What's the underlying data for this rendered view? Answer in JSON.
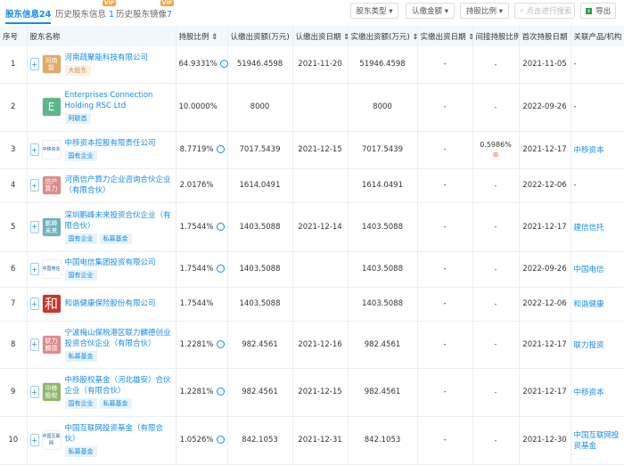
{
  "tabs": [
    {
      "label": "股东信息",
      "count": "24",
      "active": true
    },
    {
      "label": "历史股东信息",
      "count": "1",
      "vip": "VIP"
    },
    {
      "label": "历史股东镜像",
      "count": "7",
      "vip": "VIP"
    }
  ],
  "toolbar": {
    "filter_type": "股东类型 ▾",
    "filter_amount": "认缴金额 ▾",
    "filter_ratio": "持股比例 ▾",
    "search_placeholder": "点击进行搜索",
    "export": "导出"
  },
  "columns": [
    "序号",
    "股东名称",
    "持股比例 ⇕",
    "认缴出资额(万元) ⇕",
    "认缴出资日期 ⇕",
    "实缴出资额(万元) ⇕",
    "实缴出资日期 ⇕",
    "间接持股比例",
    "首次持股日期 ⇕",
    "关联产品/机构"
  ],
  "colors": {
    "accent": "#128bed",
    "header_bg": "#f2f9fc"
  },
  "rows": [
    {
      "no": "1",
      "logo": "河南\n能",
      "logo_color": "#e3a866",
      "name": "河南疏聚能科技有限公司",
      "tags": [
        "大股东"
      ],
      "ratio": "64.9331%",
      "sub_amt": "51946.4598",
      "sub_date": "2021-11-20",
      "paid_amt": "51946.4598",
      "paid_date": "-",
      "indirect": "-",
      "first_date": "2021-11-05",
      "related": "-",
      "plus": true,
      "clock": true
    },
    {
      "no": "2",
      "logo": "E",
      "logo_color": "#5cb88a",
      "name": "Enterprises Connection Holding RSC Ltd",
      "tags": [
        "阿联酋"
      ],
      "ratio": "10.0000%",
      "sub_amt": "8000",
      "sub_date": "",
      "paid_amt": "8000",
      "paid_date": "-",
      "indirect": "-",
      "first_date": "2022-09-26",
      "related": "-"
    },
    {
      "no": "3",
      "logo": "中移资本",
      "logo_color": "#ffffff",
      "name": "中移资本控股有限责任公司",
      "tags": [
        "国有企业"
      ],
      "ratio": "8.7719%",
      "sub_amt": "7017.5439",
      "sub_date": "2021-12-15",
      "paid_amt": "7017.5439",
      "paid_date": "-",
      "indirect": "0.5986%",
      "first_date": "2021-12-17",
      "related": "中移资本",
      "plus": true,
      "clock": true
    },
    {
      "no": "4",
      "logo": "信产\n算力",
      "logo_color": "#e08a8a",
      "name": "河南信产算力企业咨询合伙企业（有限合伙）",
      "tags": [],
      "ratio": "2.0176%",
      "sub_amt": "1614.0491",
      "sub_date": "",
      "paid_amt": "1614.0491",
      "paid_date": "-",
      "indirect": "-",
      "first_date": "2022-12-06",
      "related": "-",
      "plus": true
    },
    {
      "no": "5",
      "logo": "鹏峰\n未来",
      "logo_color": "#6bb3bf",
      "name": "深圳鹏峰未来投资合伙企业（有限合伙）",
      "tags": [
        "国有企业",
        "私募基金"
      ],
      "ratio": "1.7544%",
      "sub_amt": "1403.5088",
      "sub_date": "2021-12-14",
      "paid_amt": "1403.5088",
      "paid_date": "-",
      "indirect": "-",
      "first_date": "2021-12-17",
      "related": "建信信托",
      "plus": true,
      "clock": true
    },
    {
      "no": "6",
      "logo": "中国电信",
      "logo_color": "#ffffff",
      "name": "中国电信集团投资有限公司",
      "tags": [
        "国有企业"
      ],
      "ratio": "1.7544%",
      "sub_amt": "1403.5088",
      "sub_date": "",
      "paid_amt": "1403.5088",
      "paid_date": "-",
      "indirect": "-",
      "first_date": "2022-09-26",
      "related": "中国电信",
      "plus": true,
      "clock": true
    },
    {
      "no": "7",
      "logo": "和",
      "logo_color": "#d0332a",
      "name": "和谐健康保险股份有限公司",
      "tags": [],
      "ratio": "1.7544%",
      "sub_amt": "1403.5088",
      "sub_date": "",
      "paid_amt": "1403.5088",
      "paid_date": "-",
      "indirect": "-",
      "first_date": "2022-12-06",
      "related": "和谐健康",
      "plus": true
    },
    {
      "no": "8",
      "logo": "联力\n麟德",
      "logo_color": "#e08a8a",
      "name": "宁波梅山保税港区联力麟德创业投资合伙企业（有限合伙）",
      "tags": [
        "私募基金"
      ],
      "ratio": "1.2281%",
      "sub_amt": "982.4561",
      "sub_date": "2021-12-16",
      "paid_amt": "982.4561",
      "paid_date": "-",
      "indirect": "-",
      "first_date": "2021-12-17",
      "related": "联力投资",
      "plus": true,
      "clock": true
    },
    {
      "no": "9",
      "logo": "中移\n股权",
      "logo_color": "#8fb86a",
      "name": "中移股权基金（河北雄安）合伙企业（有限合伙）",
      "tags": [
        "国有企业",
        "私募基金"
      ],
      "ratio": "1.2281%",
      "sub_amt": "982.4561",
      "sub_date": "2021-12-15",
      "paid_amt": "982.4561",
      "paid_date": "-",
      "indirect": "-",
      "first_date": "2021-12-17",
      "related": "中移资本",
      "plus": true,
      "clock": true
    },
    {
      "no": "10",
      "logo": "中国互联网",
      "logo_color": "#ffffff",
      "name": "中国互联网投资基金（有限合伙）",
      "tags": [
        "私募基金"
      ],
      "ratio": "1.0526%",
      "sub_amt": "842.1053",
      "sub_date": "2021-12-31",
      "paid_amt": "842.1053",
      "paid_date": "-",
      "indirect": "-",
      "first_date": "2021-12-30",
      "related": "中国互联网投资基金",
      "plus": true,
      "clock": true
    }
  ]
}
